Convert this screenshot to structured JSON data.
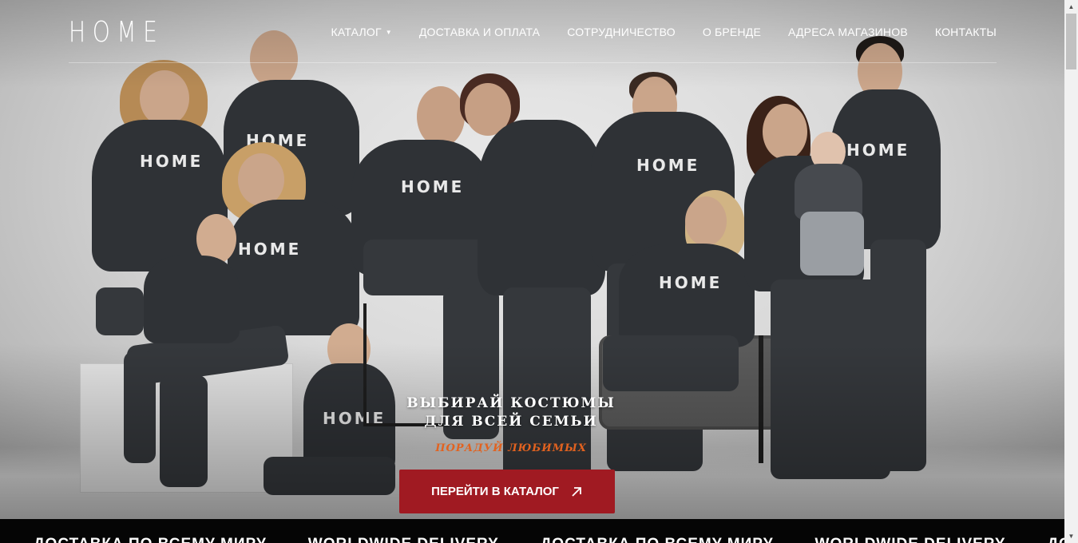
{
  "header": {
    "brand": "HOME",
    "nav": [
      {
        "label": "КАТАЛОГ",
        "has_dropdown": true
      },
      {
        "label": "ДОСТАВКА И ОПЛАТА"
      },
      {
        "label": "СОТРУДНИЧЕСТВО"
      },
      {
        "label": "О БРЕНДЕ"
      },
      {
        "label": "АДРЕСА МАГАЗИНОВ"
      },
      {
        "label": "КОНТАКТЫ"
      }
    ]
  },
  "hero": {
    "headline_line1": "ВЫБИРАЙ КОСТЮМЫ",
    "headline_line2": "ДЛЯ ВСЕЙ СЕМЬИ",
    "tagline": "ПОРАДУЙ ЛЮБИМЫХ",
    "cta_label": "ПЕРЕЙТИ В КАТАЛОГ",
    "cta_icon": "arrow-up-right-icon",
    "print_text": "HOME"
  },
  "ticker": {
    "items": [
      "ДОСТАВКА ПО ВСЕМУ МИРУ",
      "WORLDWIDE DELIVERY",
      "ДОСТАВКА ПО ВСЕМУ МИРУ",
      "WORLDWIDE DELIVERY",
      "ДОСТАВКА"
    ]
  },
  "colors": {
    "cta_background": "#a01a22",
    "tagline": "#e2621f",
    "ticker_background": "#050505"
  }
}
